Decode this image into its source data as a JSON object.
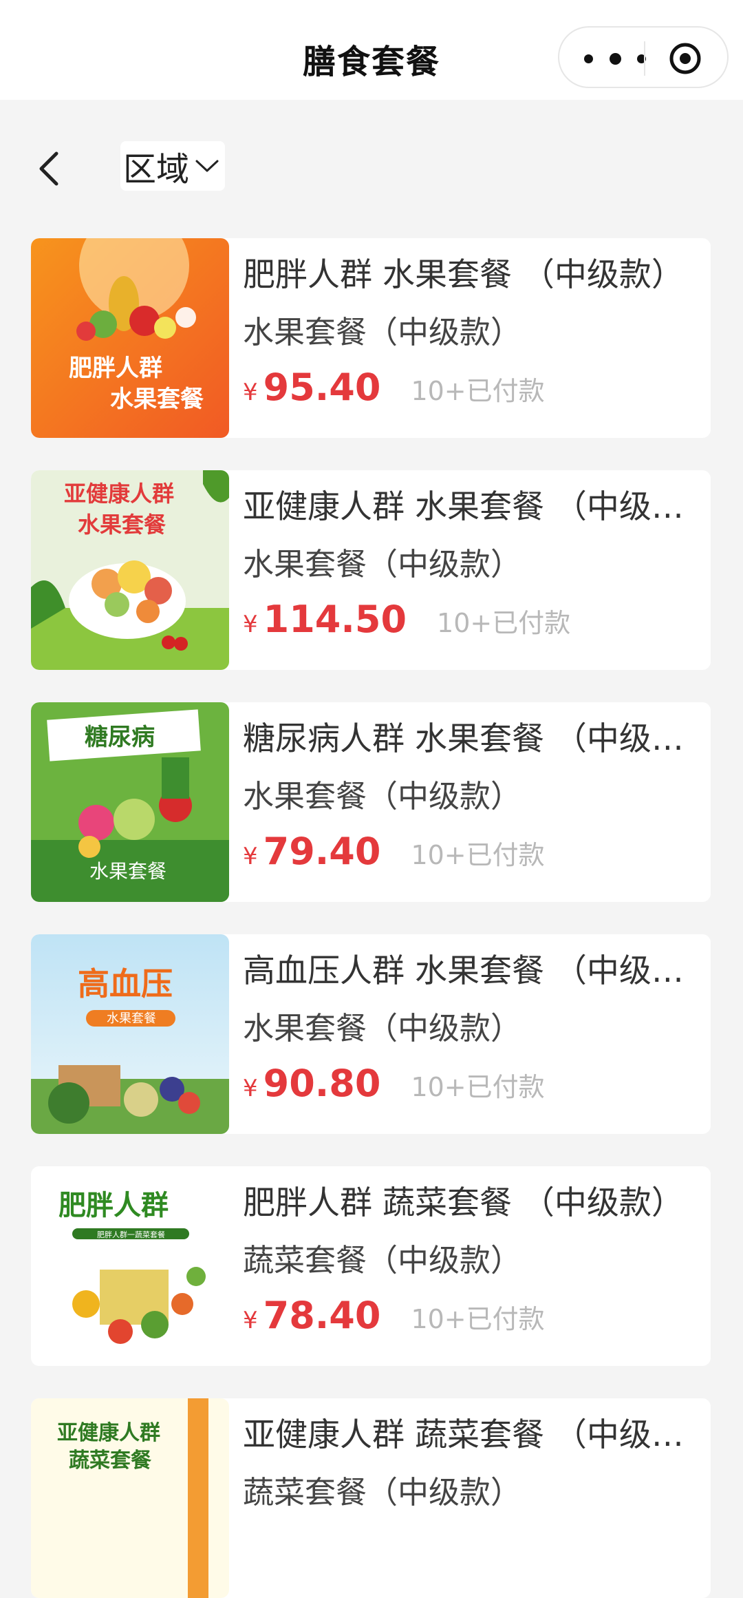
{
  "nav": {
    "title": "膳食套餐"
  },
  "filter": {
    "region_label": "区域"
  },
  "colors": {
    "price": "#e4393c",
    "sold": "#b8b8b8",
    "background": "#f4f4f4"
  },
  "products": [
    {
      "name": "肥胖人群 水果套餐 （中级款）",
      "subtitle": "水果套餐（中级款）",
      "currency": "¥",
      "price": "95.40",
      "sold": "10+已付款",
      "thumb_lines": [
        "肥胖人群",
        "水果套餐"
      ]
    },
    {
      "name": "亚健康人群 水果套餐 （中级款）",
      "subtitle": "水果套餐（中级款）",
      "currency": "¥",
      "price": "114.50",
      "sold": "10+已付款",
      "thumb_lines": [
        "亚健康人群",
        "水果套餐"
      ]
    },
    {
      "name": "糖尿病人群 水果套餐 （中级款）",
      "subtitle": "水果套餐（中级款）",
      "currency": "¥",
      "price": "79.40",
      "sold": "10+已付款",
      "thumb_lines": [
        "糖尿病",
        "水果套餐"
      ]
    },
    {
      "name": "高血压人群 水果套餐 （中级款）",
      "subtitle": "水果套餐（中级款）",
      "currency": "¥",
      "price": "90.80",
      "sold": "10+已付款",
      "thumb_lines": [
        "高血压",
        "水果套餐"
      ]
    },
    {
      "name": "肥胖人群 蔬菜套餐 （中级款）",
      "subtitle": "蔬菜套餐（中级款）",
      "currency": "¥",
      "price": "78.40",
      "sold": "10+已付款",
      "thumb_lines": [
        "肥胖人群",
        "肥胖人群一蔬菜套餐"
      ]
    },
    {
      "name": "亚健康人群 蔬菜套餐 （中级款）",
      "subtitle": "蔬菜套餐（中级款）",
      "currency": "¥",
      "price": "",
      "sold": "",
      "thumb_lines": [
        "亚健康人群",
        "蔬菜套餐"
      ]
    }
  ]
}
